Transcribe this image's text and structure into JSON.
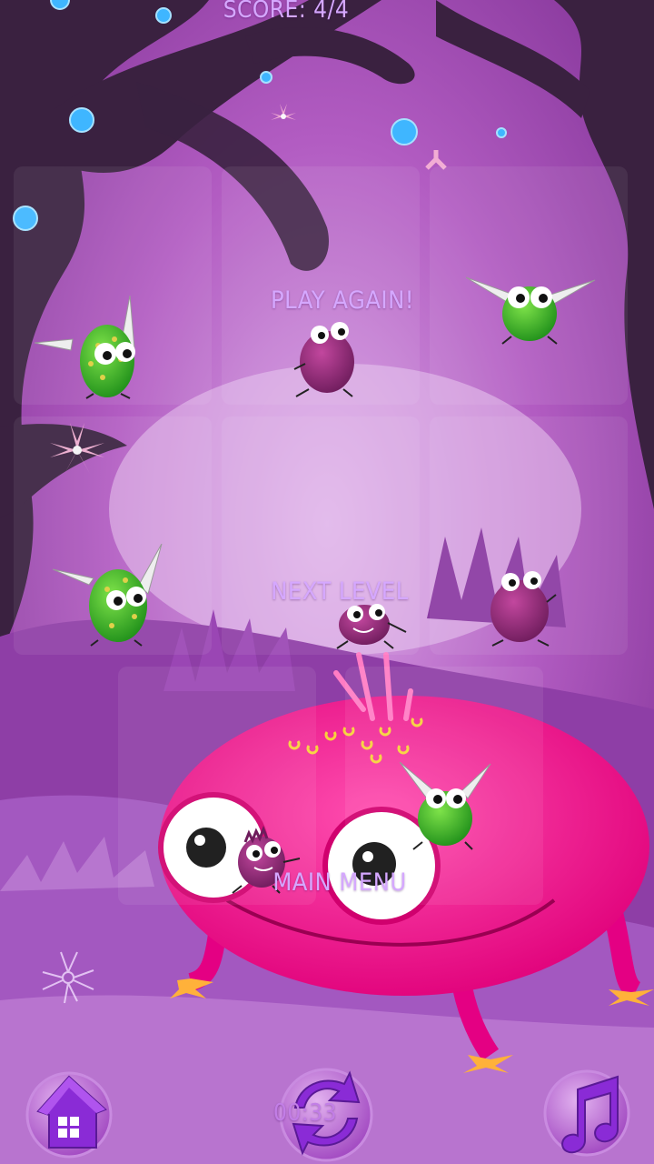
{
  "hud": {
    "score_text": "SCORE: 4/4",
    "timer_text": "00:33"
  },
  "menu": {
    "play_again_label": "PLAY AGAIN!",
    "next_level_label": "NEXT LEVEL",
    "main_menu_label": "MAIN MENU"
  },
  "icons": {
    "home": "home-icon",
    "restart": "restart-icon",
    "music": "music-note-icon"
  },
  "colors": {
    "sky": "#a94fb8",
    "tree": "#3a2140",
    "label": "#d5a8ff",
    "pink_monster": "#ff1a8c",
    "green_bug": "#3fbf2a",
    "purple_bug": "#9b2a7e",
    "orb": "#3fb6ff"
  }
}
